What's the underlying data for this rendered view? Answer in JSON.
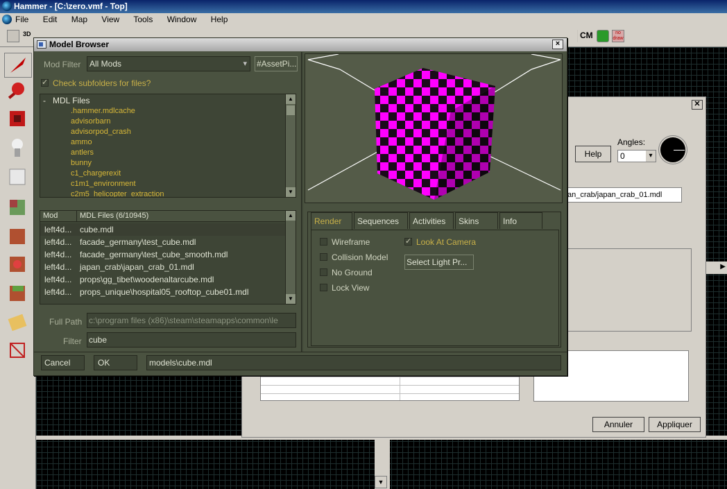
{
  "app": {
    "title": "Hammer - [C:\\zero.vmf - Top]",
    "menu": [
      "File",
      "Edit",
      "Map",
      "View",
      "Tools",
      "Window",
      "Help"
    ],
    "toolbar_labels": {
      "cm": "CM",
      "nodraw": "no draw",
      "threed": "3D"
    }
  },
  "properties_dialog": {
    "help_label": "Help",
    "angles_label": "Angles:",
    "angles_value": "0",
    "model_value": "an_crab/japan_crab_01.mdl",
    "annuler_label": "Annuler",
    "appliquer_label": "Appliquer"
  },
  "model_browser": {
    "title": "Model Browser",
    "close": "×",
    "mod_filter_label": "Mod Filter",
    "mod_filter_value": "All Mods",
    "asset_picker_label": "#AssetPi...",
    "subfolders_label": "Check subfolders for files?",
    "subfolders_checked": true,
    "tree": {
      "root_toggle": "-",
      "root_label": "MDL Files",
      "items": [
        ".hammer.mdlcache",
        "advisorbarn",
        "advisorpod_crash",
        "ammo",
        "antlers",
        "bunny",
        "c1_chargerexit",
        "c1m1_environment",
        "c2m5_helicopter_extraction"
      ]
    },
    "files": {
      "col_mod": "Mod",
      "col_files": "MDL Files (6/10945)",
      "rows": [
        {
          "mod": "left4d...",
          "file": "cube.mdl",
          "selected": true
        },
        {
          "mod": "left4d...",
          "file": "facade_germany\\test_cube.mdl",
          "selected": false
        },
        {
          "mod": "left4d...",
          "file": "facade_germany\\test_cube_smooth.mdl",
          "selected": false
        },
        {
          "mod": "left4d...",
          "file": "japan_crab\\japan_crab_01.mdl",
          "selected": false
        },
        {
          "mod": "left4d...",
          "file": "props\\gg_tibet\\woodenaltarcube.mdl",
          "selected": false
        },
        {
          "mod": "left4d...",
          "file": "props_unique\\hospital05_rooftop_cube01.mdl",
          "selected": false
        }
      ]
    },
    "full_path_label": "Full Path",
    "full_path_value": "c:\\program files (x86)\\steam\\steamapps\\common\\le",
    "filter_label": "Filter",
    "filter_value": "cube",
    "cancel_label": "Cancel",
    "ok_label": "OK",
    "model_path": "models\\cube.mdl",
    "tabs": [
      "Render",
      "Sequences",
      "Activities",
      "Skins",
      "Info"
    ],
    "active_tab": "Render",
    "render_options": {
      "wireframe": "Wireframe",
      "collision": "Collision Model",
      "no_ground": "No Ground",
      "lock_view": "Lock View",
      "look_at_camera": "Look At Camera",
      "select_light": "Select Light Pr..."
    },
    "colors": {
      "panel": "#4a5240",
      "field": "#3e4536",
      "gold_text": "#c8b048",
      "cube_pink": "#ff00ff"
    }
  }
}
